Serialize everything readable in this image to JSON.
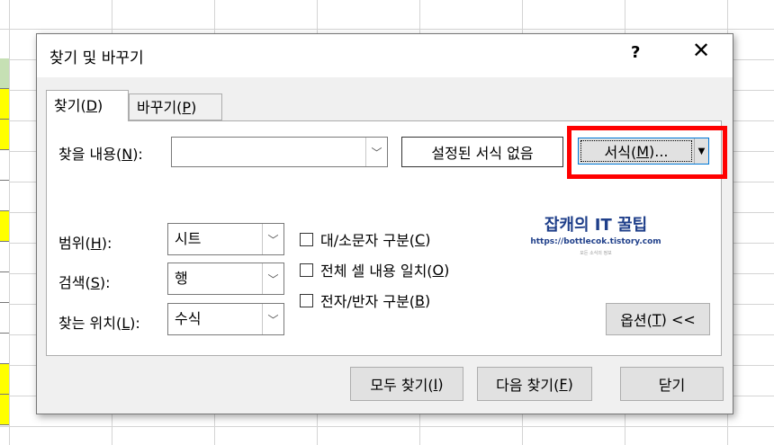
{
  "dialog": {
    "title": "찾기 및 바꾸기",
    "help_label": "?",
    "close_label": "✕"
  },
  "tabs": {
    "find": "찾기(",
    "find_key": "D",
    "replace": "바꾸기(",
    "replace_key": "P",
    "close_paren": ")"
  },
  "find_what": {
    "label": "찾을 내용(",
    "key": "N",
    "suffix": "):",
    "value": ""
  },
  "no_format_label": "설정된 서식 없음",
  "format_button": {
    "label": "서식(",
    "key": "M",
    "suffix": ")..."
  },
  "within": {
    "label": "범위(",
    "key": "H",
    "suffix": "):",
    "value": "시트"
  },
  "search": {
    "label": "검색(",
    "key": "S",
    "suffix": "):",
    "value": "행"
  },
  "look_in": {
    "label": "찾는 위치(",
    "key": "L",
    "suffix": "):",
    "value": "수식"
  },
  "checkboxes": {
    "match_case": {
      "label": "대/소문자 구분(",
      "key": "C",
      "suffix": ")"
    },
    "match_entire": {
      "label": "전체 셀 내용 일치(",
      "key": "O",
      "suffix": ")"
    },
    "match_byte": {
      "label": "전자/반자 구분(",
      "key": "B",
      "suffix": ")"
    }
  },
  "options_button": {
    "label": "옵션(",
    "key": "T",
    "suffix": ") <<"
  },
  "buttons": {
    "find_all": {
      "label": "모두 찾기(",
      "key": "I",
      "suffix": ")"
    },
    "find_next": {
      "label": "다음 찾기(",
      "key": "F",
      "suffix": ")"
    },
    "close": "닫기"
  },
  "watermark": {
    "main": "잡캐의 IT 꿀팁",
    "url": "https://bottlecok.tistory.com",
    "tiny": "모든 소식의 정보"
  },
  "colors": {
    "highlight": "#ff0000",
    "cell_yellow": "#ffff00",
    "cell_green": "#c6e0b4"
  }
}
